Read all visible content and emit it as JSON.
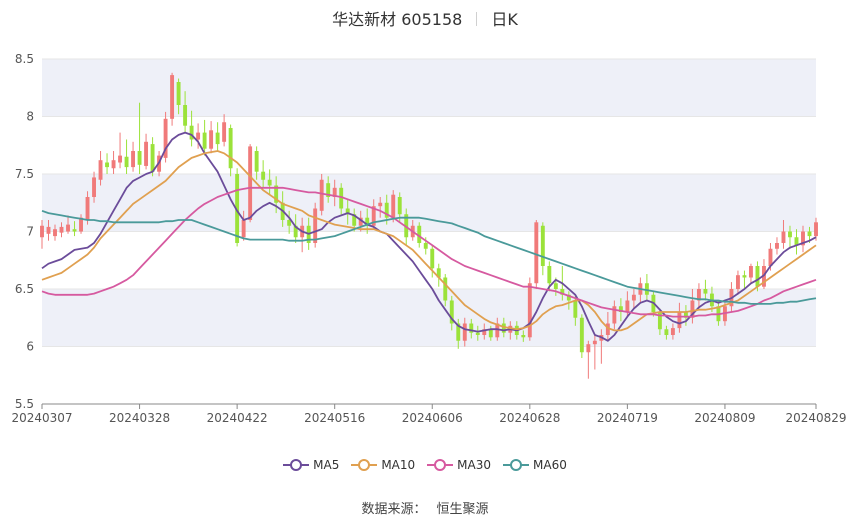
{
  "header": {
    "stock": "华达新材 605158",
    "period": "日K"
  },
  "source": {
    "label": "数据来源：",
    "name": "恒生聚源"
  },
  "colors": {
    "up": "#f07a7a",
    "down": "#9be23a",
    "grid": "#e6e6e6",
    "band": "#eef0f8",
    "ma5": "#6b4c9a",
    "ma10": "#e0a050",
    "ma30": "#d65aa0",
    "ma60": "#4a9a9a"
  },
  "chart_data": {
    "type": "candlestick",
    "ylim": [
      5.5,
      8.5
    ],
    "yticks": [
      "5.5",
      "6",
      "6.5",
      "7",
      "7.5",
      "8",
      "8.5"
    ],
    "xticks": [
      {
        "index": 0,
        "label": "20240307"
      },
      {
        "index": 15,
        "label": "20240328"
      },
      {
        "index": 30,
        "label": "20240422"
      },
      {
        "index": 45,
        "label": "20240516"
      },
      {
        "index": 60,
        "label": "20240606"
      },
      {
        "index": 75,
        "label": "20240628"
      },
      {
        "index": 90,
        "label": "20240719"
      },
      {
        "index": 105,
        "label": "20240809"
      },
      {
        "index": 119,
        "label": "20240829"
      }
    ],
    "candles": [
      [
        6.95,
        7.05,
        7.1,
        6.85
      ],
      [
        6.98,
        7.04,
        7.1,
        6.92
      ],
      [
        6.96,
        7.02,
        7.06,
        6.92
      ],
      [
        6.99,
        7.04,
        7.08,
        6.95
      ],
      [
        7.0,
        7.06,
        7.14,
        6.98
      ],
      [
        7.02,
        7.0,
        7.09,
        6.96
      ],
      [
        7.0,
        7.12,
        7.15,
        6.98
      ],
      [
        7.1,
        7.3,
        7.35,
        7.06
      ],
      [
        7.3,
        7.47,
        7.52,
        7.25
      ],
      [
        7.45,
        7.62,
        7.7,
        7.4
      ],
      [
        7.6,
        7.56,
        7.68,
        7.5
      ],
      [
        7.55,
        7.62,
        7.7,
        7.5
      ],
      [
        7.6,
        7.66,
        7.86,
        7.55
      ],
      [
        7.65,
        7.56,
        7.8,
        7.5
      ],
      [
        7.56,
        7.7,
        7.78,
        7.52
      ],
      [
        7.7,
        7.58,
        8.12,
        7.5
      ],
      [
        7.57,
        7.78,
        7.85,
        7.54
      ],
      [
        7.76,
        7.52,
        7.82,
        7.48
      ],
      [
        7.52,
        7.66,
        7.7,
        7.48
      ],
      [
        7.64,
        7.98,
        8.04,
        7.6
      ],
      [
        7.98,
        8.36,
        8.38,
        7.92
      ],
      [
        8.3,
        8.1,
        8.33,
        8.02
      ],
      [
        8.1,
        7.92,
        8.22,
        7.86
      ],
      [
        7.92,
        7.8,
        8.05,
        7.74
      ],
      [
        7.8,
        7.86,
        7.94,
        7.72
      ],
      [
        7.86,
        7.72,
        7.97,
        7.66
      ],
      [
        7.72,
        7.88,
        7.96,
        7.68
      ],
      [
        7.86,
        7.76,
        7.95,
        7.7
      ],
      [
        7.78,
        7.95,
        8.02,
        7.74
      ],
      [
        7.9,
        7.55,
        7.93,
        7.48
      ],
      [
        7.5,
        6.9,
        7.55,
        6.87
      ],
      [
        6.95,
        7.1,
        7.18,
        6.92
      ],
      [
        7.1,
        7.74,
        7.76,
        7.08
      ],
      [
        7.7,
        7.52,
        7.74,
        7.45
      ],
      [
        7.52,
        7.45,
        7.62,
        7.38
      ],
      [
        7.45,
        7.4,
        7.54,
        7.32
      ],
      [
        7.4,
        7.25,
        7.48,
        7.16
      ],
      [
        7.25,
        7.1,
        7.35,
        7.04
      ],
      [
        7.1,
        7.05,
        7.18,
        6.98
      ],
      [
        7.05,
        6.95,
        7.15,
        6.9
      ],
      [
        6.95,
        7.05,
        7.12,
        6.82
      ],
      [
        7.05,
        6.9,
        7.12,
        6.84
      ],
      [
        6.9,
        7.2,
        7.25,
        6.86
      ],
      [
        7.18,
        7.45,
        7.5,
        7.14
      ],
      [
        7.42,
        7.3,
        7.48,
        7.25
      ],
      [
        7.3,
        7.38,
        7.45,
        7.22
      ],
      [
        7.38,
        7.2,
        7.42,
        7.15
      ],
      [
        7.2,
        7.15,
        7.28,
        7.06
      ],
      [
        7.15,
        7.05,
        7.2,
        7.0
      ],
      [
        7.05,
        7.12,
        7.18,
        7.0
      ],
      [
        7.12,
        7.05,
        7.2,
        6.98
      ],
      [
        7.05,
        7.22,
        7.28,
        7.02
      ],
      [
        7.22,
        7.25,
        7.3,
        7.12
      ],
      [
        7.25,
        7.12,
        7.32,
        7.06
      ],
      [
        7.12,
        7.32,
        7.36,
        7.08
      ],
      [
        7.3,
        7.15,
        7.34,
        7.08
      ],
      [
        7.15,
        6.95,
        7.2,
        6.88
      ],
      [
        6.95,
        7.05,
        7.1,
        6.92
      ],
      [
        7.05,
        6.9,
        7.08,
        6.86
      ],
      [
        6.9,
        6.85,
        6.95,
        6.8
      ],
      [
        6.85,
        6.68,
        6.88,
        6.6
      ],
      [
        6.68,
        6.6,
        6.72,
        6.52
      ],
      [
        6.6,
        6.4,
        6.63,
        6.35
      ],
      [
        6.4,
        6.2,
        6.44,
        6.14
      ],
      [
        6.2,
        6.05,
        6.24,
        5.98
      ],
      [
        6.05,
        6.2,
        6.25,
        6.0
      ],
      [
        6.2,
        6.12,
        6.24,
        6.07
      ],
      [
        6.12,
        6.1,
        6.18,
        6.05
      ],
      [
        6.1,
        6.15,
        6.2,
        6.06
      ],
      [
        6.15,
        6.08,
        6.18,
        6.05
      ],
      [
        6.08,
        6.2,
        6.25,
        6.05
      ],
      [
        6.2,
        6.12,
        6.25,
        6.08
      ],
      [
        6.12,
        6.18,
        6.22,
        6.06
      ],
      [
        6.18,
        6.1,
        6.22,
        6.06
      ],
      [
        6.1,
        6.08,
        6.14,
        6.04
      ],
      [
        6.08,
        6.55,
        6.6,
        6.05
      ],
      [
        6.55,
        7.08,
        7.1,
        6.5
      ],
      [
        7.05,
        6.7,
        7.08,
        6.62
      ],
      [
        6.7,
        6.55,
        6.74,
        6.48
      ],
      [
        6.55,
        6.5,
        6.6,
        6.44
      ],
      [
        6.5,
        6.45,
        6.7,
        6.4
      ],
      [
        6.45,
        6.4,
        6.48,
        6.32
      ],
      [
        6.4,
        6.25,
        6.44,
        6.18
      ],
      [
        6.25,
        5.95,
        6.28,
        5.9
      ],
      [
        5.95,
        6.02,
        6.05,
        5.72
      ],
      [
        6.02,
        6.05,
        6.1,
        5.8
      ],
      [
        6.05,
        6.1,
        6.15,
        5.85
      ],
      [
        6.1,
        6.2,
        6.3,
        6.06
      ],
      [
        6.2,
        6.35,
        6.4,
        6.15
      ],
      [
        6.35,
        6.3,
        6.42,
        6.22
      ],
      [
        6.3,
        6.4,
        6.48,
        6.26
      ],
      [
        6.4,
        6.45,
        6.5,
        6.33
      ],
      [
        6.45,
        6.55,
        6.6,
        6.38
      ],
      [
        6.55,
        6.45,
        6.63,
        6.4
      ],
      [
        6.45,
        6.3,
        6.48,
        6.26
      ],
      [
        6.3,
        6.15,
        6.33,
        6.1
      ],
      [
        6.15,
        6.1,
        6.18,
        6.06
      ],
      [
        6.1,
        6.16,
        6.2,
        6.06
      ],
      [
        6.16,
        6.3,
        6.38,
        6.12
      ],
      [
        6.3,
        6.25,
        6.36,
        6.18
      ],
      [
        6.25,
        6.4,
        6.5,
        6.2
      ],
      [
        6.4,
        6.5,
        6.55,
        6.33
      ],
      [
        6.5,
        6.46,
        6.58,
        6.4
      ],
      [
        6.46,
        6.35,
        6.52,
        6.3
      ],
      [
        6.35,
        6.22,
        6.4,
        6.18
      ],
      [
        6.22,
        6.35,
        6.4,
        6.18
      ],
      [
        6.35,
        6.5,
        6.56,
        6.3
      ],
      [
        6.5,
        6.62,
        6.66,
        6.45
      ],
      [
        6.62,
        6.6,
        6.66,
        6.5
      ],
      [
        6.6,
        6.7,
        6.72,
        6.55
      ],
      [
        6.7,
        6.52,
        6.74,
        6.48
      ],
      [
        6.52,
        6.7,
        6.76,
        6.5
      ],
      [
        6.7,
        6.85,
        6.9,
        6.66
      ],
      [
        6.85,
        6.9,
        6.95,
        6.8
      ],
      [
        6.9,
        7.0,
        7.1,
        6.85
      ],
      [
        7.0,
        6.95,
        7.05,
        6.85
      ],
      [
        6.95,
        6.88,
        7.02,
        6.8
      ],
      [
        6.88,
        7.0,
        7.05,
        6.82
      ],
      [
        7.0,
        6.96,
        7.04,
        6.9
      ],
      [
        6.96,
        7.08,
        7.12,
        6.92
      ]
    ],
    "series": [
      {
        "name": "MA5",
        "color": "#6b4c9a",
        "values": [
          6.68,
          6.72,
          6.74,
          6.76,
          6.8,
          6.84,
          6.85,
          6.86,
          6.9,
          6.98,
          7.08,
          7.18,
          7.28,
          7.38,
          7.44,
          7.47,
          7.5,
          7.52,
          7.6,
          7.72,
          7.8,
          7.84,
          7.86,
          7.84,
          7.78,
          7.68,
          7.6,
          7.52,
          7.4,
          7.28,
          7.18,
          7.1,
          7.12,
          7.18,
          7.22,
          7.25,
          7.22,
          7.18,
          7.12,
          7.04,
          7.0,
          6.98,
          7.0,
          7.02,
          7.08,
          7.12,
          7.14,
          7.16,
          7.14,
          7.1,
          7.06,
          7.04,
          7.0,
          6.98,
          6.92,
          6.86,
          6.8,
          6.74,
          6.66,
          6.58,
          6.5,
          6.4,
          6.32,
          6.24,
          6.18,
          6.15,
          6.14,
          6.13,
          6.14,
          6.15,
          6.15,
          6.14,
          6.15,
          6.14,
          6.16,
          6.2,
          6.3,
          6.42,
          6.52,
          6.58,
          6.55,
          6.5,
          6.45,
          6.35,
          6.22,
          6.1,
          6.08,
          6.05,
          6.1,
          6.18,
          6.26,
          6.33,
          6.38,
          6.4,
          6.38,
          6.32,
          6.26,
          6.22,
          6.2,
          6.22,
          6.28,
          6.34,
          6.38,
          6.4,
          6.38,
          6.4,
          6.42,
          6.46,
          6.5,
          6.55,
          6.58,
          6.62,
          6.7,
          6.76,
          6.82,
          6.86,
          6.88,
          6.9,
          6.92,
          6.95
        ]
      },
      {
        "name": "MA10",
        "color": "#e0a050",
        "values": [
          6.58,
          6.6,
          6.62,
          6.64,
          6.68,
          6.72,
          6.76,
          6.8,
          6.86,
          6.94,
          7.0,
          7.06,
          7.12,
          7.18,
          7.24,
          7.28,
          7.32,
          7.36,
          7.4,
          7.44,
          7.5,
          7.56,
          7.6,
          7.64,
          7.66,
          7.68,
          7.69,
          7.7,
          7.68,
          7.64,
          7.6,
          7.54,
          7.48,
          7.42,
          7.36,
          7.32,
          7.28,
          7.24,
          7.22,
          7.2,
          7.18,
          7.14,
          7.12,
          7.1,
          7.08,
          7.06,
          7.05,
          7.04,
          7.03,
          7.02,
          7.02,
          7.02,
          7.0,
          6.98,
          6.96,
          6.92,
          6.88,
          6.84,
          6.78,
          6.72,
          6.66,
          6.6,
          6.54,
          6.48,
          6.42,
          6.36,
          6.32,
          6.28,
          6.24,
          6.21,
          6.19,
          6.17,
          6.16,
          6.15,
          6.16,
          6.18,
          6.22,
          6.28,
          6.32,
          6.35,
          6.36,
          6.38,
          6.4,
          6.4,
          6.36,
          6.3,
          6.22,
          6.16,
          6.14,
          6.14,
          6.16,
          6.2,
          6.24,
          6.28,
          6.29,
          6.3,
          6.3,
          6.3,
          6.3,
          6.3,
          6.31,
          6.32,
          6.32,
          6.33,
          6.34,
          6.36,
          6.38,
          6.4,
          6.44,
          6.48,
          6.52,
          6.56,
          6.6,
          6.64,
          6.68,
          6.72,
          6.76,
          6.8,
          6.84,
          6.88
        ]
      },
      {
        "name": "MA30",
        "color": "#d65aa0",
        "values": [
          6.48,
          6.46,
          6.45,
          6.45,
          6.45,
          6.45,
          6.45,
          6.45,
          6.46,
          6.48,
          6.5,
          6.52,
          6.55,
          6.58,
          6.62,
          6.68,
          6.74,
          6.8,
          6.86,
          6.92,
          6.98,
          7.04,
          7.1,
          7.15,
          7.2,
          7.24,
          7.27,
          7.3,
          7.32,
          7.34,
          7.36,
          7.37,
          7.38,
          7.38,
          7.38,
          7.38,
          7.38,
          7.38,
          7.37,
          7.36,
          7.35,
          7.34,
          7.34,
          7.33,
          7.32,
          7.31,
          7.3,
          7.28,
          7.26,
          7.24,
          7.22,
          7.2,
          7.18,
          7.15,
          7.12,
          7.08,
          7.04,
          7.0,
          6.96,
          6.92,
          6.88,
          6.84,
          6.8,
          6.76,
          6.73,
          6.7,
          6.68,
          6.66,
          6.64,
          6.62,
          6.6,
          6.58,
          6.56,
          6.54,
          6.52,
          6.52,
          6.51,
          6.5,
          6.49,
          6.48,
          6.46,
          6.44,
          6.42,
          6.4,
          6.38,
          6.36,
          6.34,
          6.33,
          6.32,
          6.31,
          6.3,
          6.29,
          6.28,
          6.28,
          6.28,
          6.27,
          6.27,
          6.26,
          6.26,
          6.26,
          6.26,
          6.27,
          6.27,
          6.28,
          6.28,
          6.29,
          6.3,
          6.31,
          6.33,
          6.35,
          6.37,
          6.4,
          6.42,
          6.45,
          6.48,
          6.5,
          6.52,
          6.54,
          6.56,
          6.58
        ]
      },
      {
        "name": "MA60",
        "color": "#4a9a9a",
        "values": [
          7.18,
          7.16,
          7.15,
          7.14,
          7.13,
          7.12,
          7.11,
          7.1,
          7.1,
          7.09,
          7.09,
          7.08,
          7.08,
          7.08,
          7.08,
          7.08,
          7.08,
          7.08,
          7.08,
          7.09,
          7.09,
          7.1,
          7.1,
          7.1,
          7.08,
          7.06,
          7.04,
          7.02,
          7.0,
          6.98,
          6.96,
          6.94,
          6.93,
          6.93,
          6.93,
          6.93,
          6.93,
          6.93,
          6.92,
          6.92,
          6.92,
          6.93,
          6.93,
          6.94,
          6.95,
          6.96,
          6.98,
          7.0,
          7.02,
          7.04,
          7.06,
          7.08,
          7.09,
          7.1,
          7.11,
          7.12,
          7.12,
          7.12,
          7.12,
          7.11,
          7.1,
          7.09,
          7.08,
          7.07,
          7.05,
          7.03,
          7.01,
          6.99,
          6.96,
          6.94,
          6.92,
          6.9,
          6.88,
          6.86,
          6.84,
          6.82,
          6.8,
          6.78,
          6.76,
          6.74,
          6.72,
          6.7,
          6.68,
          6.66,
          6.64,
          6.62,
          6.6,
          6.58,
          6.56,
          6.54,
          6.52,
          6.51,
          6.5,
          6.49,
          6.48,
          6.47,
          6.46,
          6.45,
          6.44,
          6.43,
          6.42,
          6.41,
          6.41,
          6.4,
          6.4,
          6.39,
          6.39,
          6.38,
          6.38,
          6.37,
          6.37,
          6.37,
          6.37,
          6.38,
          6.38,
          6.39,
          6.39,
          6.4,
          6.41,
          6.42
        ]
      }
    ]
  }
}
